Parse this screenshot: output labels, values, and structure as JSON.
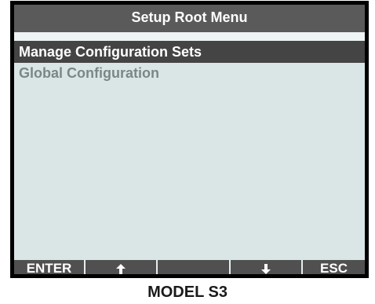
{
  "screen": {
    "title": "Setup Root Menu",
    "menu_items": [
      {
        "label": "Manage Configuration Sets",
        "selected": true
      },
      {
        "label": "Global Configuration",
        "selected": false
      }
    ]
  },
  "softkeys": {
    "enter": "ENTER",
    "up_icon": "up-arrow-icon",
    "blank": "",
    "down_icon": "down-arrow-icon",
    "esc": "ESC"
  },
  "model": "MODEL S3",
  "colors": {
    "bezel": "#000000",
    "screen_bg": "#dae6e6",
    "title_bg": "#5a5a5a",
    "selected_bg": "#444444",
    "unselected_text": "#7d8686",
    "softkey_bg": "#505050"
  }
}
